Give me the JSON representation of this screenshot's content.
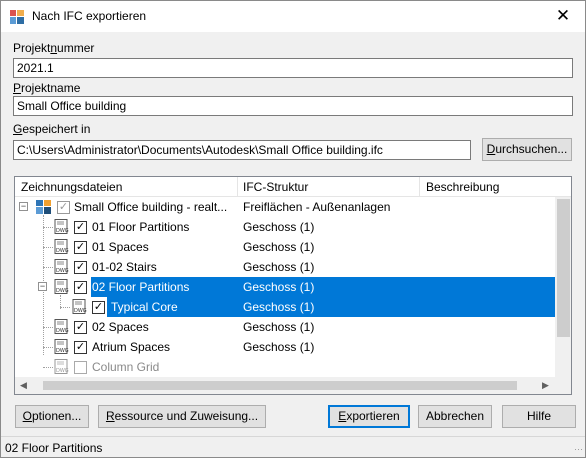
{
  "window": {
    "title": "Nach IFC exportieren",
    "close_glyph": "✕"
  },
  "fields": {
    "project_number": {
      "label_prefix": "Projekt",
      "label_accel": "n",
      "label_suffix": "ummer",
      "value": "2021.1"
    },
    "project_name": {
      "label_prefix": "",
      "label_accel": "P",
      "label_suffix": "rojektname",
      "value": "Small Office building"
    },
    "saved_in": {
      "label_prefix": "",
      "label_accel": "G",
      "label_suffix": "espeichert in",
      "value": "C:\\Users\\Administrator\\Documents\\Autodesk\\Small Office building.ifc"
    }
  },
  "browse_button": {
    "accel": "D",
    "rest": "urchsuchen..."
  },
  "tree": {
    "columns": [
      "Zeichnungsdateien",
      "IFC-Struktur",
      "Beschreibung"
    ],
    "rows": [
      {
        "name": "Small Office building - realt...",
        "ifc": "Freiflächen - Außenanlagen",
        "level": 0,
        "checked": "dim",
        "icon": "building-icon",
        "expander": "−"
      },
      {
        "name": "01 Floor Partitions",
        "ifc": "Geschoss (1)",
        "level": 1,
        "checked": "on",
        "icon": "dwg-file-icon"
      },
      {
        "name": "01 Spaces",
        "ifc": "Geschoss (1)",
        "level": 1,
        "checked": "on",
        "icon": "dwg-file-icon"
      },
      {
        "name": "01-02 Stairs",
        "ifc": "Geschoss (1)",
        "level": 1,
        "checked": "on",
        "icon": "dwg-file-icon"
      },
      {
        "name": "02 Floor Partitions",
        "ifc": "Geschoss (1)",
        "level": 1,
        "checked": "on",
        "icon": "dwg-file-icon",
        "expander": "−",
        "selected": true
      },
      {
        "name": "Typical Core",
        "ifc": "Geschoss (1)",
        "level": 2,
        "checked": "on",
        "icon": "dwg-file-icon",
        "selected": true
      },
      {
        "name": "02 Spaces",
        "ifc": "Geschoss (1)",
        "level": 1,
        "checked": "on",
        "icon": "dwg-file-icon"
      },
      {
        "name": "Atrium Spaces",
        "ifc": "Geschoss (1)",
        "level": 1,
        "checked": "on",
        "icon": "dwg-file-icon"
      },
      {
        "name": "Column Grid",
        "ifc": "",
        "level": 1,
        "checked": "off",
        "icon": "dwg-file-icon",
        "disabled": true
      }
    ]
  },
  "buttons": {
    "options": {
      "accel": "O",
      "rest": "ptionen..."
    },
    "resources": {
      "accel": "R",
      "rest": "essource und Zuweisung..."
    },
    "export": {
      "accel": "E",
      "rest": "xportieren"
    },
    "cancel": "Abbrechen",
    "help": "Hilfe"
  },
  "status": "02 Floor Partitions",
  "colors": {
    "selection": "#0078d7",
    "focus_border": "#0078d7"
  },
  "check_glyph": "✓"
}
